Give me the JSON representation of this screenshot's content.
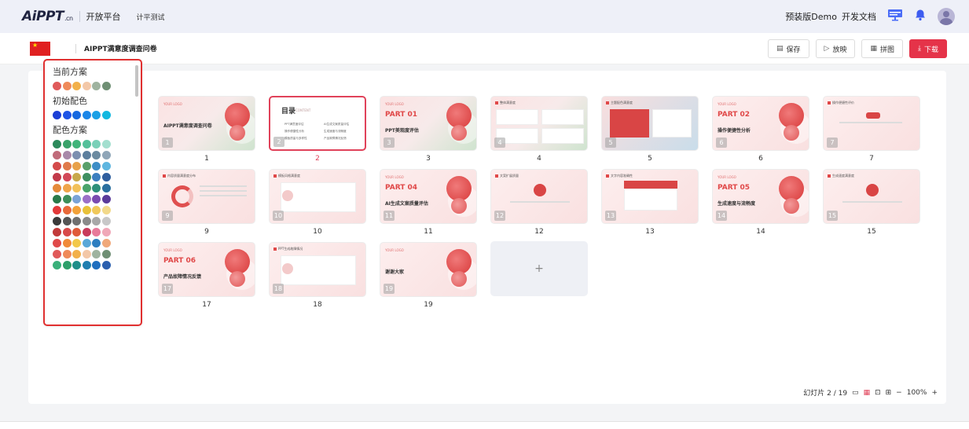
{
  "nav": {
    "logo": "AiPPT",
    "logo_suffix": ".cn",
    "platform": "开放平台",
    "project": "计平测试",
    "demo_link": "预装版Demo",
    "docs_link": "开发文档"
  },
  "toolbar": {
    "doc_title": "AIPPT满意度调查问卷",
    "save_label": "保存",
    "play_label": "放映",
    "collage_label": "拼图",
    "download_label": "下载"
  },
  "color_panel": {
    "current_title": "当前方案",
    "initial_title": "初始配色",
    "schemes_title": "配色方案",
    "current": [
      [
        "#e05a5a",
        "#ef8a5a",
        "#f2b04a",
        "#f3c8a8",
        "#9fb39f",
        "#6f8f74"
      ]
    ],
    "initial": [
      [
        "#1c3fd6",
        "#1f55e6",
        "#1769e0",
        "#1b86e8",
        "#1aa0e6",
        "#12b8e0"
      ]
    ],
    "schemes": [
      [
        "#2c8a5b",
        "#3aa36a",
        "#41b47a",
        "#55c09a",
        "#7ad0b8",
        "#a3dfcf"
      ],
      [
        "#c06b7a",
        "#a989a9",
        "#7c8fb0",
        "#5d7f9e",
        "#6b8aa0",
        "#8fa6b8"
      ],
      [
        "#d44a4a",
        "#e07a4a",
        "#e8a14a",
        "#5aa06a",
        "#3e8ec6",
        "#5fb6e0"
      ],
      [
        "#c23a4a",
        "#d24858",
        "#c8a84a",
        "#3f8f5f",
        "#3b7fbf",
        "#2e5e9e"
      ],
      [
        "#e58a3a",
        "#efa54a",
        "#f2c15a",
        "#4aa36a",
        "#2e8f7a",
        "#2a6f9f"
      ],
      [
        "#2a7a4a",
        "#3e8f5a",
        "#7aa3d6",
        "#9b6fc8",
        "#7a4ab0",
        "#5a3a9a"
      ],
      [
        "#e23a3a",
        "#e86a3a",
        "#f2a23a",
        "#e8c13a",
        "#f0c85a",
        "#f2d98a"
      ],
      [
        "#3a3a3a",
        "#555555",
        "#707070",
        "#8a8a8a",
        "#a8a8a8",
        "#c8c8c8"
      ],
      [
        "#c23a3a",
        "#d84a4a",
        "#e05a3a",
        "#c83a5a",
        "#e87a9a",
        "#f0a8b8"
      ],
      [
        "#e04a4a",
        "#f08a3a",
        "#f2c84a",
        "#5aa8d8",
        "#2e7ec0",
        "#f0a87a"
      ],
      [
        "#e05a5a",
        "#ef8a5a",
        "#f2b04a",
        "#f3c8a8",
        "#9fb39f",
        "#6f8f74"
      ],
      [
        "#3ab07a",
        "#2e9f6a",
        "#1f8f8a",
        "#1f7fb0",
        "#1f6fbf",
        "#2a5fae"
      ]
    ]
  },
  "slides": [
    {
      "num": "1",
      "logo": "YOUR LOGO",
      "head": "",
      "sub": "AIPPT满意度调查问卷",
      "style": "cover"
    },
    {
      "num": "2",
      "title": "目录",
      "en": "CONTENT",
      "items": [
        "PPT满意度评估",
        "AI生成文案质量评估",
        "操作便捷性分析",
        "生成速度与流畅度",
        "模板质量与多样性",
        "产品故障情况反馈"
      ],
      "style": "toc"
    },
    {
      "num": "3",
      "logo": "YOUR LOGO",
      "head": "PART 01",
      "sub": "PPT美观度评估",
      "style": "part"
    },
    {
      "num": "4",
      "hdr": "整体满意度",
      "style": "cards"
    },
    {
      "num": "5",
      "hdr": "主题配色满意度",
      "style": "blue"
    },
    {
      "num": "6",
      "logo": "YOUR LOGO",
      "head": "PART 02",
      "sub": "操作便捷性分析",
      "style": "part"
    },
    {
      "num": "7",
      "hdr": "操作便捷性评价",
      "style": "tag"
    },
    {
      "num": "9",
      "hdr": "内容质量满意度分布",
      "style": "pie"
    },
    {
      "num": "10",
      "hdr": "模板风格满意度",
      "style": "icon"
    },
    {
      "num": "11",
      "logo": "YOUR LOGO",
      "head": "PART 04",
      "sub": "AI生成文案质量评估",
      "style": "part"
    },
    {
      "num": "12",
      "hdr": "文案扩展质量",
      "style": "hex"
    },
    {
      "num": "13",
      "hdr": "文字内容准确性",
      "style": "banner"
    },
    {
      "num": "14",
      "logo": "YOUR LOGO",
      "head": "PART 05",
      "sub": "生成速度与流畅度",
      "style": "part"
    },
    {
      "num": "15",
      "hdr": "生成速度满意度",
      "style": "hex"
    },
    {
      "num": "17",
      "logo": "YOUR LOGO",
      "head": "PART 06",
      "sub": "产品故障情况反馈",
      "style": "part"
    },
    {
      "num": "18",
      "hdr": "PPT生成故障情况",
      "style": "quote"
    },
    {
      "num": "19",
      "logo": "YOUR LOGO",
      "head": "",
      "sub": "谢谢大家",
      "style": "cover"
    }
  ],
  "add_slide_symbol": "+",
  "status": {
    "counter": "幻灯片 2 / 19",
    "zoom_minus": "−",
    "zoom": "100%",
    "zoom_plus": "+"
  },
  "colors": {
    "accent": "#e0425a",
    "download_bg": "#e53349",
    "panel_border": "#e03030"
  },
  "icons": [
    "bell-icon",
    "monitor-icon",
    "avatar",
    "save-icon",
    "play-icon",
    "collage-icon",
    "download-icon",
    "grid-view-icon",
    "fit-icon"
  ]
}
